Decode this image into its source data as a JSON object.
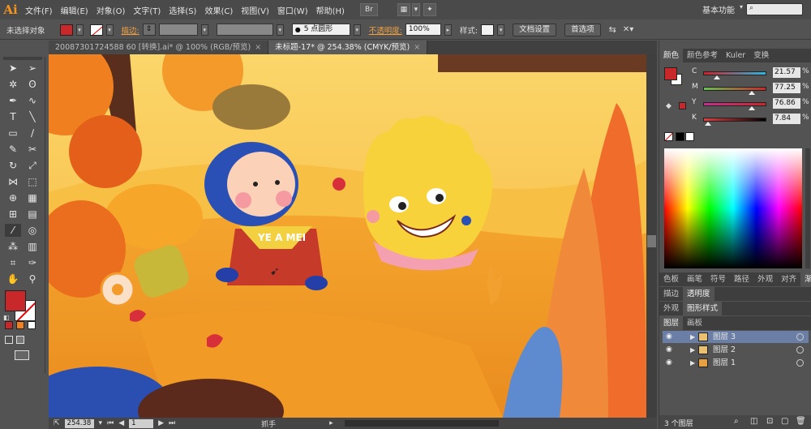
{
  "app": {
    "logo": "Ai",
    "workspace": "基本功能"
  },
  "menu": [
    "文件(F)",
    "编辑(E)",
    "对象(O)",
    "文字(T)",
    "选择(S)",
    "效果(C)",
    "视图(V)",
    "窗口(W)",
    "帮助(H)"
  ],
  "menubar_buttons": {
    "br": "Br",
    "arrange": "▦"
  },
  "control": {
    "no_selection": "未选择对象",
    "stroke_label": "描边:",
    "brush": "5 点圆形",
    "opacity_label": "不透明度:",
    "opacity_value": "100%",
    "style_label": "样式:",
    "doc_setup": "文档设置",
    "preferences": "首选项",
    "colors": {
      "fill": "#c8282a",
      "accent": "#f0a040"
    }
  },
  "tabs": [
    {
      "label": "20087301724588 60 [转换].ai* @ 100% (RGB/预览)",
      "close": "×"
    },
    {
      "label": "未标题-17* @ 254.38% (CMYK/预览)",
      "close": "×"
    }
  ],
  "canvas": {
    "shirt_text": "YE A MEI"
  },
  "status": {
    "zoom": "254.38",
    "page": "1",
    "tool_name": "抓手"
  },
  "color_panel": {
    "tabs": [
      "颜色",
      "颜色参考",
      "Kuler",
      "变换"
    ],
    "sliders": [
      {
        "letter": "C",
        "value": "21.57",
        "pct": 0.22,
        "gradient": "linear-gradient(to right,#d0202a,#2ab8e0)"
      },
      {
        "letter": "M",
        "value": "77.25",
        "pct": 0.77,
        "gradient": "linear-gradient(to right,#66c050,#c8282a)"
      },
      {
        "letter": "Y",
        "value": "76.86",
        "pct": 0.77,
        "gradient": "linear-gradient(to right,#c03090,#c8282a)"
      },
      {
        "letter": "K",
        "value": "7.84",
        "pct": 0.08,
        "gradient": "linear-gradient(to right,#e04040,#000)"
      }
    ]
  },
  "panel_group2": {
    "tabs": [
      "色板",
      "画笔",
      "符号",
      "路径",
      "外观",
      "对齐",
      "渐变"
    ]
  },
  "panel_group3": {
    "tabs": [
      "描边",
      "透明度"
    ]
  },
  "panel_group4": {
    "tabs": [
      "外观",
      "图形样式"
    ]
  },
  "layers_panel": {
    "tabs": [
      "图层",
      "画板"
    ],
    "layers": [
      {
        "name": "图层 3",
        "color": "#e8c070",
        "selected": true
      },
      {
        "name": "图层 2",
        "color": "#e8c070",
        "selected": false
      },
      {
        "name": "图层 1",
        "color": "#e8a040",
        "selected": false
      }
    ],
    "count": "3 个图层"
  }
}
